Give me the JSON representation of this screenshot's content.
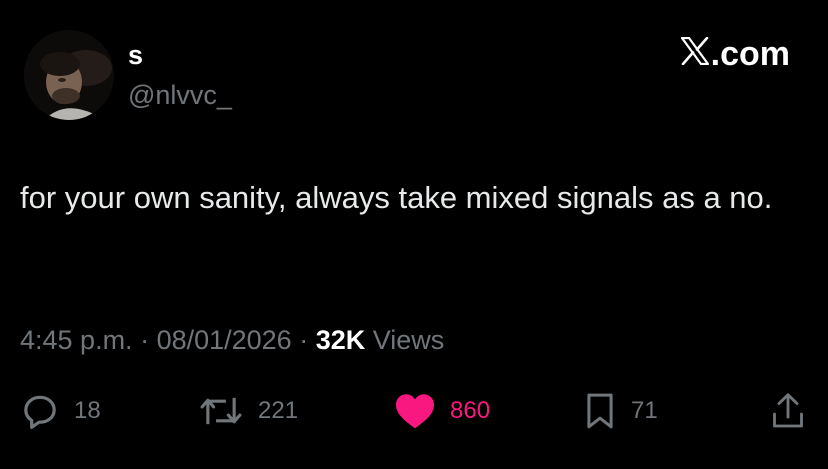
{
  "author": {
    "display_name": "s",
    "handle": "@nlvvc_",
    "avatar_icon": "profile-photo"
  },
  "brand": {
    "icon": "x-logo-icon",
    "suffix": ".com"
  },
  "tweet": {
    "text": "for your own sanity, always take mixed signals as a no."
  },
  "meta": {
    "time": "4:45 p.m.",
    "separator1": " · ",
    "date": "08/01/2026",
    "separator2": " · ",
    "views_count": "32K",
    "views_label": "Views"
  },
  "actions": {
    "reply": {
      "icon": "reply-icon",
      "count": "18"
    },
    "repost": {
      "icon": "repost-icon",
      "count": "221"
    },
    "like": {
      "icon": "heart-icon",
      "count": "860",
      "liked": true,
      "color": "#f91880"
    },
    "bookmark": {
      "icon": "bookmark-icon",
      "count": "71"
    },
    "share": {
      "icon": "share-icon"
    }
  },
  "colors": {
    "background": "#000000",
    "primary_text": "#e7e9ea",
    "secondary_text": "#71767b",
    "like_pink": "#f91880"
  }
}
